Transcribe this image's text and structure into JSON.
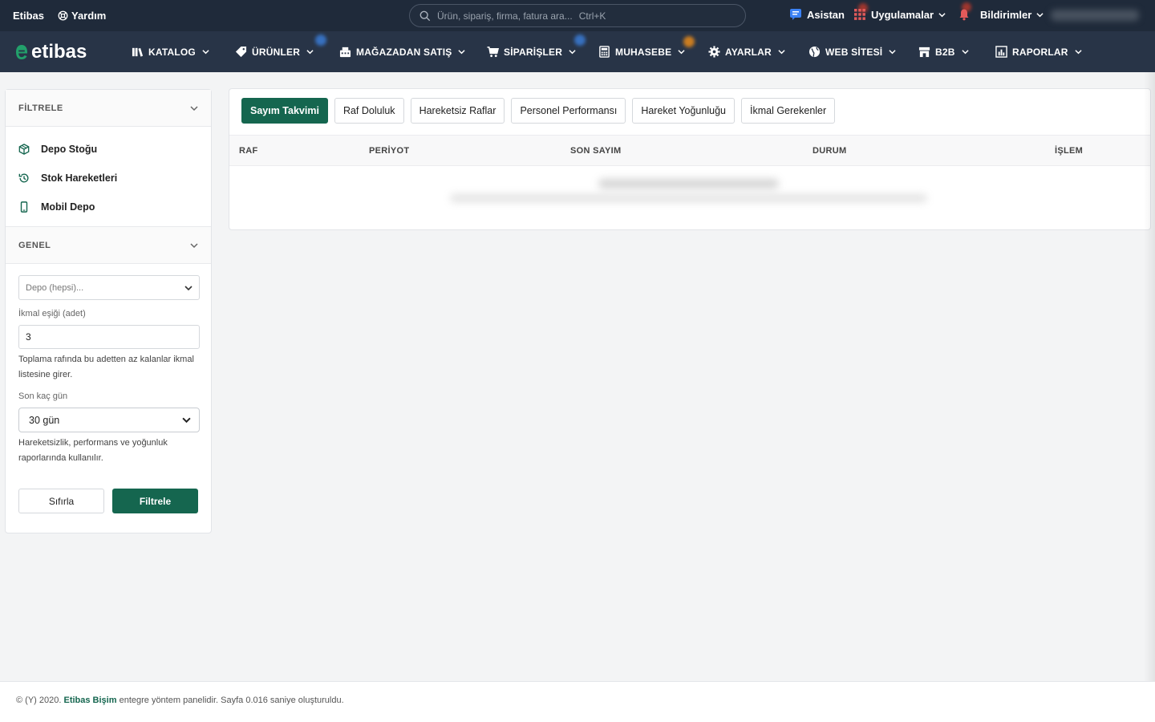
{
  "topbar": {
    "brand": "Etibas",
    "help": "Yardım",
    "search_placeholder": "Ürün, sipariş, firma, fatura ara...",
    "search_shortcut": "Ctrl+K",
    "assistant": "Asistan",
    "apps": "Uygulamalar",
    "notifications": "Bildirimler"
  },
  "nav": {
    "logo": "etibas",
    "items": [
      {
        "label": "KATALOG",
        "icon": "books-icon"
      },
      {
        "label": "ÜRÜNLER",
        "icon": "tag-icon"
      },
      {
        "label": "MAĞAZADAN SATIŞ",
        "icon": "register-icon"
      },
      {
        "label": "SİPARİŞLER",
        "icon": "cart-icon"
      },
      {
        "label": "MUHASEBE",
        "icon": "calculator-icon"
      },
      {
        "label": "AYARLAR",
        "icon": "gear-icon"
      },
      {
        "label": "WEB SİTESİ",
        "icon": "globe-icon"
      },
      {
        "label": "B2B",
        "icon": "store-icon"
      },
      {
        "label": "RAPORLAR",
        "icon": "report-icon"
      }
    ]
  },
  "sidebar": {
    "filter_title": "FİLTRELE",
    "links": [
      {
        "label": "Depo Stoğu",
        "icon": "cube-icon"
      },
      {
        "label": "Stok Hareketleri",
        "icon": "history-icon"
      },
      {
        "label": "Mobil Depo",
        "icon": "mobile-icon"
      }
    ],
    "general_title": "GENEL",
    "warehouse_placeholder": "Depo (hepsi)...",
    "restock_label": "İkmal eşiği (adet)",
    "restock_value": "3",
    "restock_help": "Toplama rafında bu adetten az kalanlar ikmal listesine girer.",
    "days_label": "Son kaç gün",
    "days_value": "30 gün",
    "days_help": "Hareketsizlik, performans ve yoğunluk raporlarında kullanılır.",
    "reset_button": "Sıfırla",
    "filter_button": "Filtrele"
  },
  "content": {
    "tabs": [
      "Sayım Takvimi",
      "Raf Doluluk",
      "Hareketsiz Raflar",
      "Personel Performansı",
      "Hareket Yoğunluğu",
      "İkmal Gerekenler"
    ],
    "active_tab": 0,
    "columns": [
      "RAF",
      "PERİYOT",
      "SON SAYIM",
      "DURUM",
      "İŞLEM"
    ]
  },
  "footer": {
    "prefix": "© (Y) 2020.",
    "link": "Etibas Bişim",
    "suffix": "entegre yöntem panelidir. Sayfa 0.016 saniye oluşturuldu."
  },
  "colors": {
    "topbar_bg": "#1f2a3a",
    "nav_bg": "#283447",
    "accent": "#15664f"
  }
}
